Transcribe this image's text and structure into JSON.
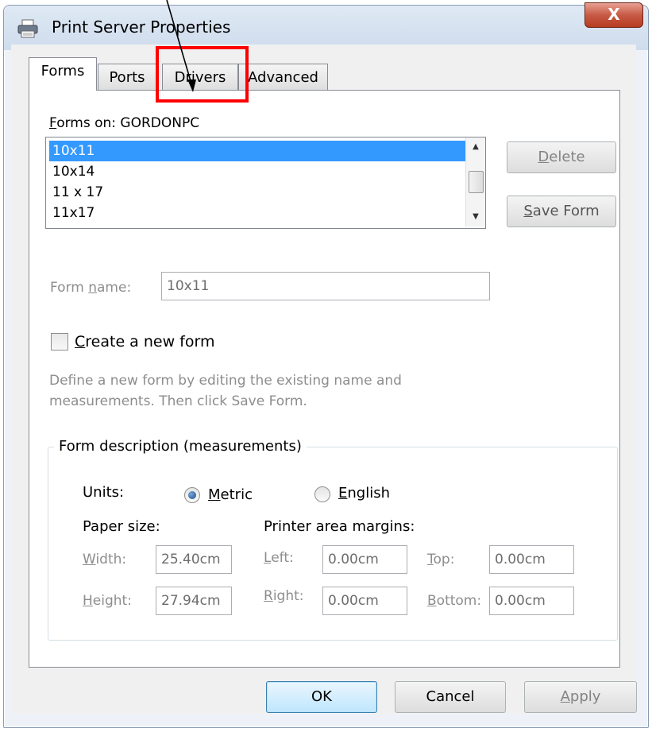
{
  "window": {
    "title": "Print Server Properties",
    "close_label": "X"
  },
  "tabs": [
    {
      "label": "Forms"
    },
    {
      "label": "Ports"
    },
    {
      "label": "Drivers"
    },
    {
      "label": "Advanced"
    }
  ],
  "forms": {
    "forms_on_label": "orms on:",
    "forms_on_mnemonic": "F",
    "server_name": "GORDONPC",
    "list_items": [
      "10x11",
      "10x14",
      "11 x 17",
      "11x17"
    ],
    "selected_index": 0,
    "delete_label": "elete",
    "delete_mnemonic": "D",
    "save_form_label": "ave Form",
    "save_form_mnemonic": "S",
    "form_name_label_a": "Form ",
    "form_name_label_b": "ame:",
    "form_name_mnemonic": "n",
    "form_name_value": "10x11",
    "create_new_mnemonic": "C",
    "create_new_label": "reate a new form",
    "create_new_checked": false,
    "help_line1": "Define a new form by editing the existing name and",
    "help_line2": "measurements.  Then click Save Form."
  },
  "measurements": {
    "group_title": "Form description (measurements)",
    "units_label": "Units:",
    "metric_mnemonic": "M",
    "metric_label": "etric",
    "english_mnemonic": "E",
    "english_label": "nglish",
    "selected_unit": "Metric",
    "paper_size_label": "Paper size:",
    "margins_label": "Printer area margins:",
    "width_mnemonic": "W",
    "width_label": "idth:",
    "width_value": "25.40cm",
    "height_mnemonic": "H",
    "height_label": "eight:",
    "height_value": "27.94cm",
    "left_mnemonic": "L",
    "left_label": "eft:",
    "left_value": "0.00cm",
    "right_mnemonic": "R",
    "right_label": "ight:",
    "right_value": "0.00cm",
    "top_mnemonic": "T",
    "top_label": "op:",
    "top_value": "0.00cm",
    "bottom_mnemonic": "B",
    "bottom_label": "ottom:",
    "bottom_value": "0.00cm"
  },
  "footer": {
    "ok_label": "OK",
    "cancel_label": "Cancel",
    "apply_mnemonic": "A",
    "apply_label": "pply"
  },
  "annotation": {
    "highlight_color": "#ff0000",
    "target_tab": "Drivers"
  }
}
